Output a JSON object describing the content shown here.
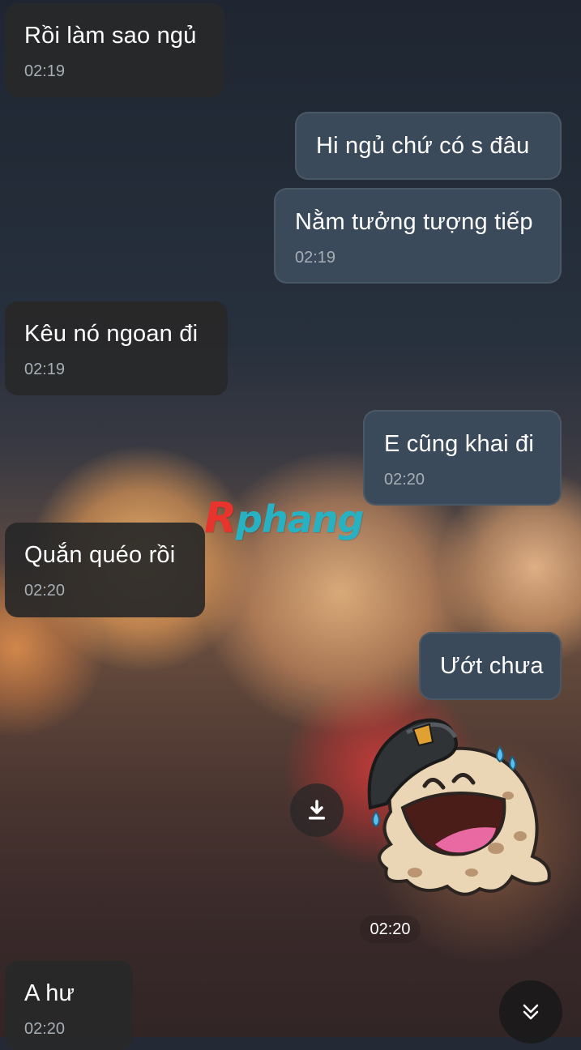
{
  "chat": {
    "messages": [
      {
        "side": "left",
        "text": "Rồi làm sao ngủ",
        "time": "02:19"
      },
      {
        "side": "right",
        "text": "Hi ngủ chứ có s đâu",
        "time": ""
      },
      {
        "side": "right",
        "text": "Nằm tưởng tượng tiếp",
        "time": "02:19"
      },
      {
        "side": "left",
        "text": "Kêu nó ngoan đi",
        "time": "02:19"
      },
      {
        "side": "right",
        "text": "E cũng khai đi",
        "time": "02:20"
      },
      {
        "side": "left",
        "text": "Quắn quéo rồi",
        "time": "02:20"
      },
      {
        "side": "right",
        "text": "Ướt chưa",
        "time": ""
      },
      {
        "side": "left",
        "text": "A hư",
        "time": "02:20"
      }
    ],
    "sticker": {
      "icon": "laughing-soldier-sticker",
      "time": "02:20"
    }
  },
  "watermark": {
    "prefix": "R",
    "text": "phang"
  },
  "icons": {
    "download": "download-icon",
    "scroll_down": "double-chevron-down-icon"
  },
  "colors": {
    "bubble_left": "#282828",
    "bubble_right": "#3b4a5a",
    "watermark_blue": "#27b2c4",
    "watermark_red": "#e8342d"
  }
}
